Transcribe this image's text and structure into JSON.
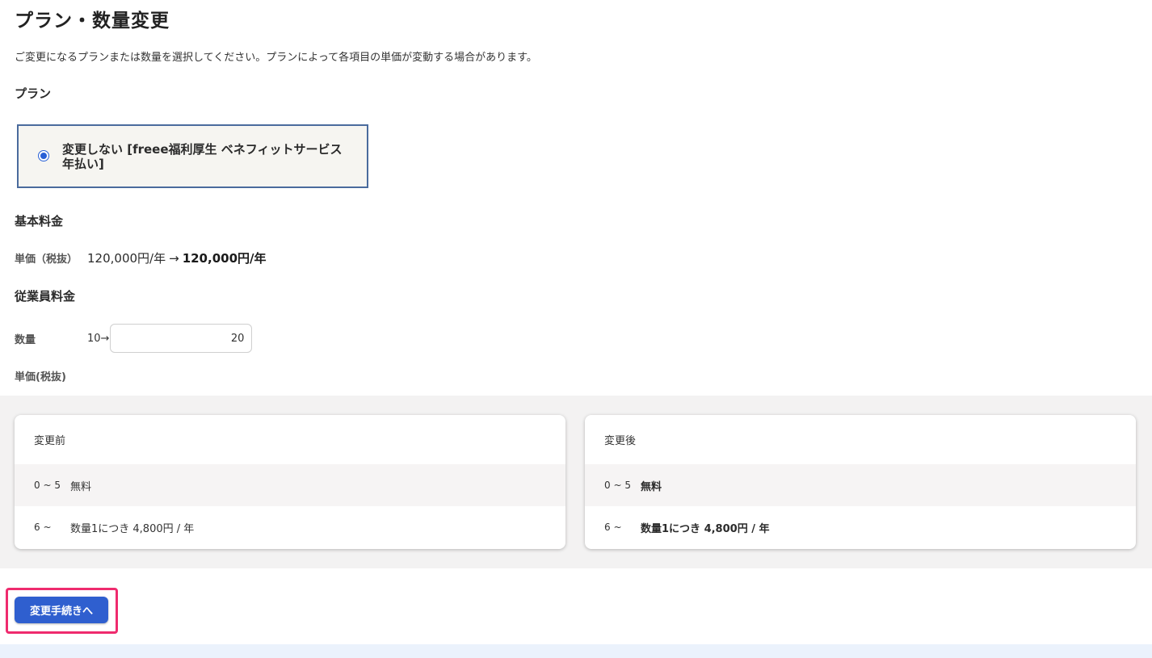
{
  "page": {
    "title": "プラン・数量変更",
    "description": "ご変更になるプランまたは数量を選択してください。プランによって各項目の単価が変動する場合があります。"
  },
  "plan_section": {
    "heading": "プラン",
    "option": {
      "label": "変更しない [freee福利厚生 ベネフィットサービス 年払い]",
      "selected": true
    }
  },
  "base_fee": {
    "heading": "基本料金",
    "unit_price_label": "単価（税抜）",
    "old_price": "120,000円/年",
    "arrow": "→",
    "new_price": "120,000円/年"
  },
  "employee_fee": {
    "heading": "従業員料金",
    "quantity_label": "数量",
    "old_quantity": "10",
    "arrow": "→",
    "new_quantity": "20",
    "unit_price_label": "単価(税抜)"
  },
  "comparison": {
    "before": {
      "title": "変更前",
      "tiers": [
        {
          "range": "0 ~ 5",
          "price": "無料"
        },
        {
          "range": "6 ~",
          "price": "数量1につき 4,800円 / 年"
        }
      ]
    },
    "after": {
      "title": "変更後",
      "tiers": [
        {
          "range": "0 ~ 5",
          "price": "無料"
        },
        {
          "range": "6 ~",
          "price": "数量1につき 4,800円 / 年"
        }
      ]
    }
  },
  "actions": {
    "proceed_label": "変更手続きへ"
  },
  "colors": {
    "primary_button": "#2f5fcf",
    "highlight_border": "#ef2b6e",
    "plan_card_border": "#4a6b9d",
    "radio_accent": "#2860d6"
  }
}
